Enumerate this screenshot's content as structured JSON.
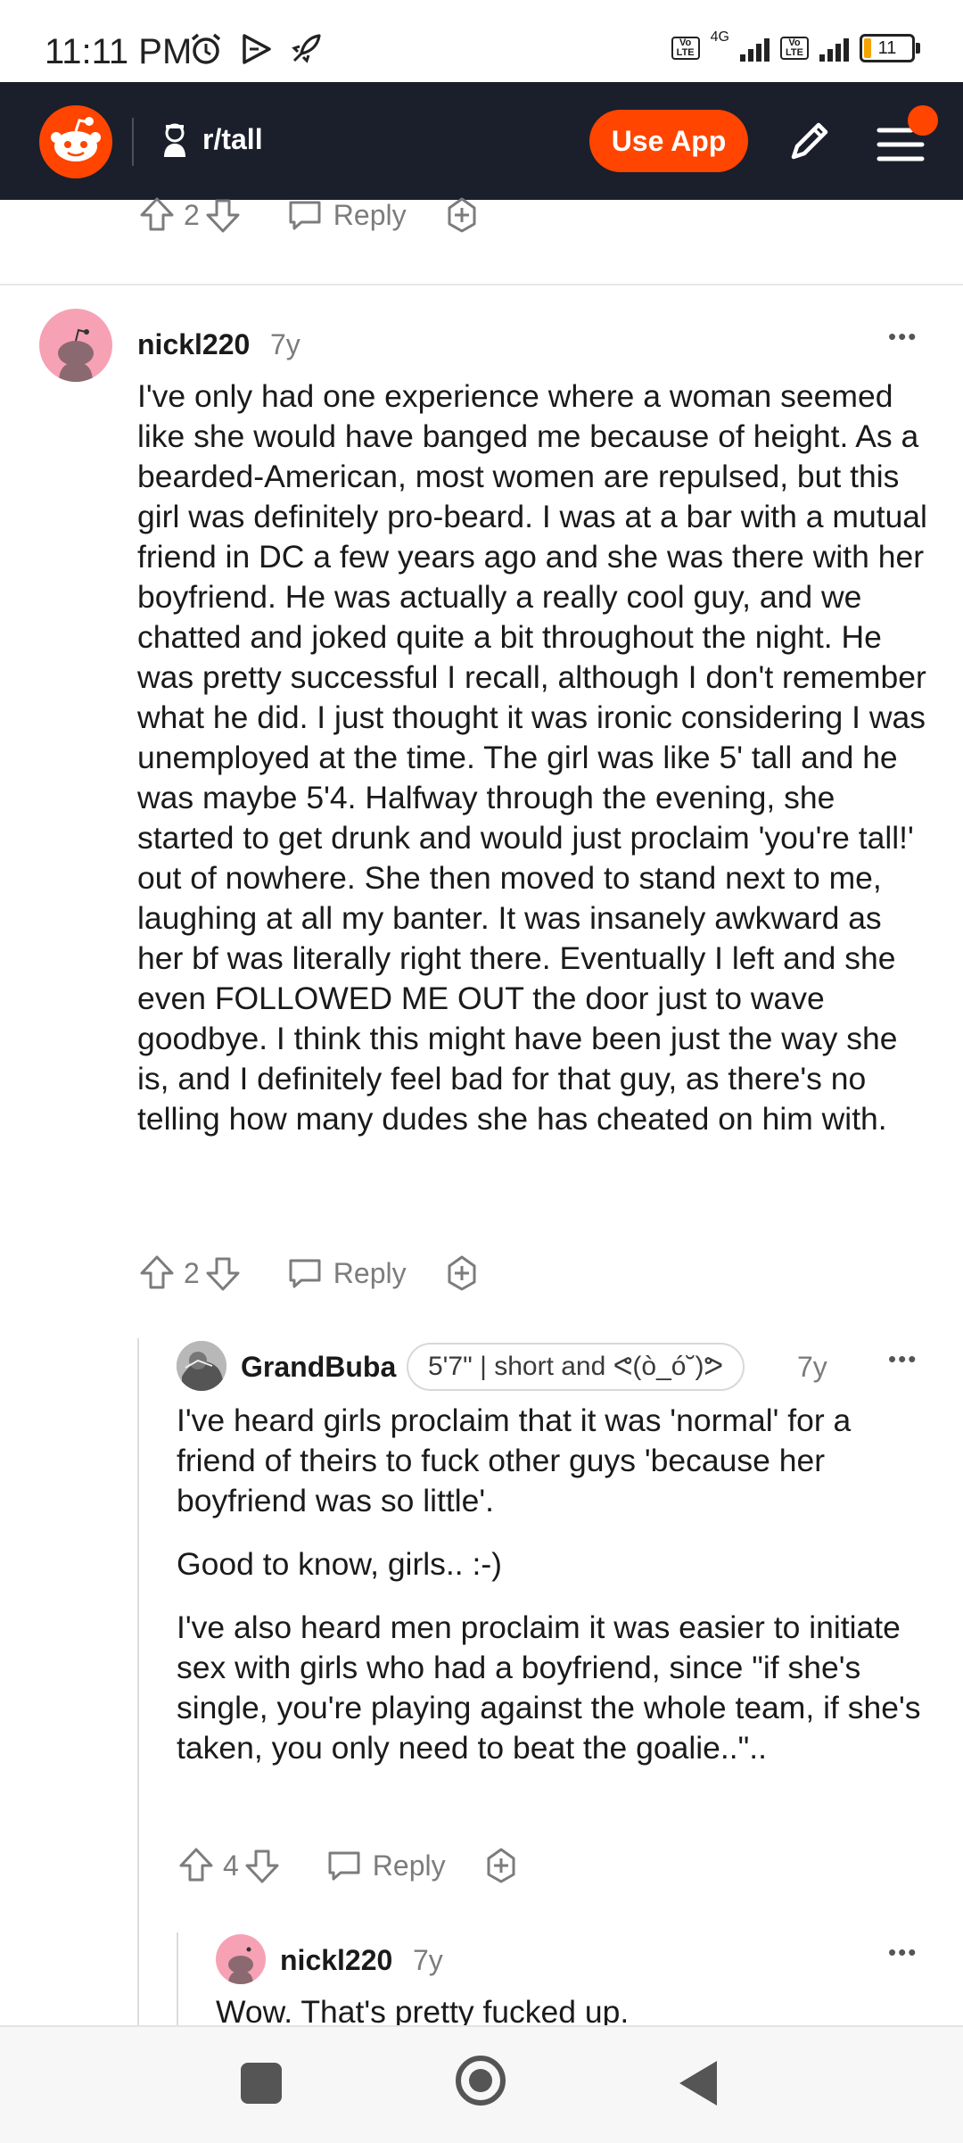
{
  "status_bar": {
    "time": "11:11 PM",
    "network_label": "4G",
    "sim_label": "Vo LTE",
    "battery_level": "11"
  },
  "header": {
    "subreddit": "r/tall",
    "use_app_label": "Use App"
  },
  "prev_comment": {
    "score": "2",
    "reply_label": "Reply"
  },
  "comments": [
    {
      "author": "nickl220",
      "age": "7y",
      "paragraphs": [
        "I've only had one experience where a woman seemed like she would have banged me because of height. As a bearded-American, most women are repulsed, but this girl was definitely pro-beard. I was at a bar with a mutual friend in DC a few years ago and she was there with her boyfriend. He was actually a really cool guy, and we chatted and joked quite a bit throughout the night. He was pretty successful I recall, although I don't remember what he did. I just thought it was ironic considering I was unemployed at the time. The girl was like 5' tall and he was maybe 5'4. Halfway through the evening, she started to get drunk and would just proclaim 'you're tall!' out of nowhere. She then moved to stand next to me, laughing at all my banter. It was insanely awkward as her bf was literally right there. Eventually I left and she even FOLLOWED ME OUT the door just to wave goodbye. I think this might have been just the way she is, and I definitely feel bad for that guy, as there's no telling how many dudes she has cheated on him with."
      ],
      "score": "2",
      "reply_label": "Reply"
    },
    {
      "author": "GrandBuba",
      "flair": "5'7\" | short and ᕙ(ò_ó˘)ᕗ",
      "age": "7y",
      "paragraphs": [
        "I've heard girls proclaim that it was 'normal' for a friend of theirs to fuck other guys 'because her boyfriend was so little'.",
        "Good to know, girls.. :-)",
        "I've also heard men proclaim it was easier to initiate sex with girls who had a boyfriend, since \"if she's single, you're playing against the whole team, if she's taken, you only need to beat the goalie..\".."
      ],
      "score": "4",
      "reply_label": "Reply"
    },
    {
      "author": "nickl220",
      "age": "7y",
      "paragraphs": [
        "Wow. That's pretty fucked up."
      ]
    }
  ],
  "more_label": "•••",
  "colors": {
    "header_bg": "#1a1f2b",
    "accent": "#ff4500",
    "meta_gray": "#7c7c7c"
  }
}
